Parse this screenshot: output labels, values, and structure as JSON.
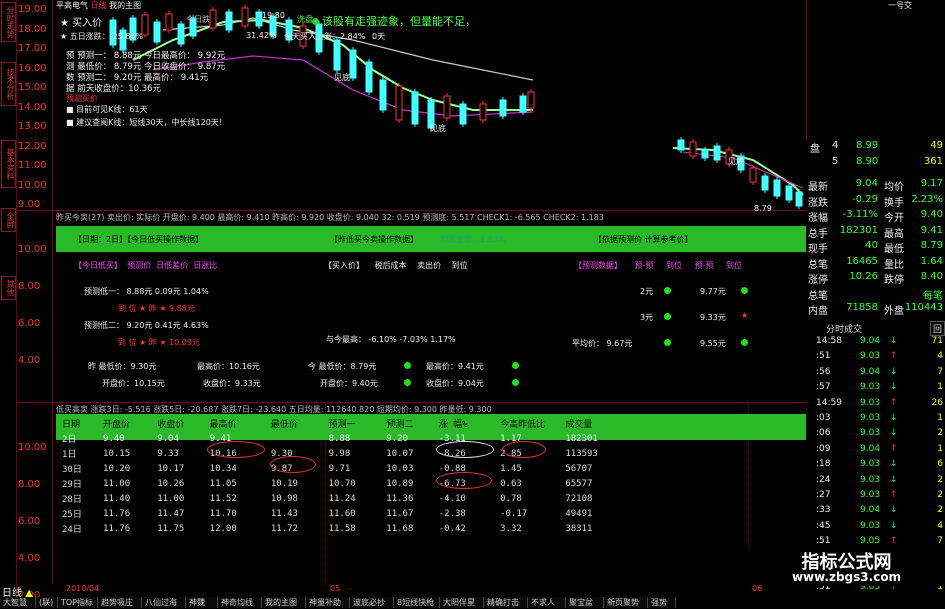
{
  "header": {
    "stock_name": "平高电气",
    "period_tag": "日线",
    "my_subject": "我的主图",
    "top_right": "一号交",
    "high_mark": "19.80",
    "buy_label": "买入价",
    "signal_text": "该股有走强迹象，但量能不足，",
    "five_day": "五日涨跌：-25.86%",
    "today_rise": "今日跌",
    "kc_label": "今天买入上涨：2.84%",
    "zero_day": "0天",
    "val_3142": "31.42%",
    "cm": "洗盘"
  },
  "info_overlay": {
    "lines": [
      "预  预测一： 8.88元   今日最高价： 9.92元",
      "测  最低价： 8.79元   今日收盘价： 9.87元",
      "数  预测二： 9.20元   最高价：   9.41元",
      "据                    前天收盘价：10.36元"
    ],
    "buy_sign": "预测买价",
    "visible": "目前可见K线：61天",
    "advice": "建议查阅K线：短线30天，中长线120天！"
  },
  "chart_labels": {
    "jiandi1": "见底",
    "jiandi2": "见底",
    "jiandi3": "见底",
    "low_mark": "8.79",
    "month": "2010/04",
    "month2": "05",
    "month3": "06"
  },
  "y_axis": [
    "19.00",
    "18.00",
    "17.00",
    "16.00",
    "15.00",
    "14.00",
    "13.00",
    "12.00",
    "11.00",
    "10.00",
    "9.00"
  ],
  "y_axis_mid": [
    "10.00",
    "8.00",
    "6.00",
    "4.00"
  ],
  "y_axis_bot": [
    "10.00",
    "8.00",
    "6.00",
    "4.00",
    "2.00"
  ],
  "left_tabs": [
    "分时走势",
    "技术分析",
    "基本资料",
    "全屏",
    "其他"
  ],
  "mid_header": {
    "text": "昨买今卖(27)  卖出价: 实际价  开盘价: 9.400  最高价: 9.410  昨高价: 9.920  收盘价: 9.040  32: 0.519  预测底: 5.517  CHECK1: -6.565  CHECK2: 1.183"
  },
  "section1": {
    "left": "【日期：2日】【今日低买操作数据】",
    "mid": "【昨低买今卖操作数据】",
    "mid2": "利润金额：1.93%",
    "right": "【依据预测价 计算参考价】"
  },
  "panel1": {
    "tabs_left": [
      "【今日低买】",
      "预测价",
      "日低差价",
      "日涨比"
    ],
    "tabs_mid": [
      "【买入价】",
      "税后成本",
      "卖出价",
      "到位"
    ],
    "tabs_right": [
      "【预测数据】",
      "预-预",
      "到位",
      "预-预",
      "到位"
    ],
    "pred1": "预测低一：  8.88元    0.09元    1.04%",
    "pos1": "到 位  ★  昨 ★ 9.88元",
    "pred2": "预测低二：  9.20元    0.41元    4.63%",
    "pos2": "到 位  ★  昨 ★ 10.09元",
    "diff_row": "与今最高：  -6.10%     -7.03%     1.17%",
    "r1": "2元",
    "r1v": "9.77元",
    "r2": "3元",
    "r2v": "9.33元",
    "avg": "平均价：  9.67元",
    "avgv": "9.55元",
    "yest_low": "昨  最低价：9.30元",
    "yest_high": "最高价：10.16元",
    "open": "开盘价：10.15元",
    "close": "收盘价：9.33元",
    "t_low": "今  最低价：8.79元",
    "t_high": "最高价：9.41元",
    "t_open": "开盘价：9.40元",
    "t_close": "收盘价：9.04元"
  },
  "low_header": {
    "text": "低买高卖  涨跌3日: -5.516  涨跌5日: -20.687  涨跌7日: -23.640  五日均量: 112640.820  短期均价: 9.300  昨量低: 9.300"
  },
  "table": {
    "headers": [
      "日期",
      "开盘价",
      "收盘价",
      "最高价",
      "最低价",
      "预测一",
      "预测二",
      "涨  幅%",
      "今高昨低比",
      "成交量"
    ],
    "rows": [
      [
        "2日",
        "9.40",
        "9.04",
        "9.41",
        "",
        "8.88",
        "9.20",
        "-3.11",
        "1.17",
        "182301"
      ],
      [
        "1日",
        "10.15",
        "9.33",
        "10.16",
        "9.30",
        "9.98",
        "10.07",
        "-8.26",
        "2.85",
        "113593"
      ],
      [
        "30日",
        "10.20",
        "10.17",
        "10.34",
        "9.87",
        "9.71",
        "10.03",
        "-0.88",
        "1.45",
        "56707"
      ],
      [
        "29日",
        "11.00",
        "10.26",
        "11.05",
        "10.19",
        "10.70",
        "10.89",
        "-6.73",
        "0.63",
        "65577"
      ],
      [
        "28日",
        "11.40",
        "11.00",
        "11.52",
        "10.98",
        "11.24",
        "11.36",
        "-4.10",
        "0.78",
        "72108"
      ],
      [
        "25日",
        "11.76",
        "11.47",
        "11.70",
        "11.43",
        "11.60",
        "11.67",
        "-2.38",
        "-0.17",
        "49491"
      ],
      [
        "24日",
        "11.76",
        "11.75",
        "12.00",
        "11.72",
        "11.58",
        "11.68",
        "-0.42",
        "3.32",
        "38311"
      ]
    ]
  },
  "right_panel": {
    "book": [
      [
        "盘",
        "4",
        "8.99",
        "49"
      ],
      [
        "",
        "5",
        "8.90",
        "361"
      ]
    ],
    "stats": [
      [
        "最新",
        "9.04",
        "均价",
        "9.17"
      ],
      [
        "涨跌",
        "-0.29",
        "换手",
        "2.23%"
      ],
      [
        "涨幅",
        "-3.11%",
        "今开",
        "9.40"
      ],
      [
        "总手",
        "182301",
        "最高",
        "9.41"
      ],
      [
        "现手",
        "40",
        "最低",
        "8.79"
      ],
      [
        "总笔",
        "16465",
        "量比",
        "1.64"
      ],
      [
        "涨停",
        "10.26",
        "跌停",
        "8.40"
      ],
      [
        "总笔",
        "",
        "",
        "每笔"
      ],
      [
        "内盘",
        "71858",
        "外盘",
        "110443"
      ]
    ],
    "tick_title": "分时成交",
    "tick_tab": "回",
    "ticks": [
      [
        "14:58",
        "9.04",
        "71"
      ],
      [
        ":51",
        "9.03",
        "4"
      ],
      [
        ":56",
        "9.04",
        "7"
      ],
      [
        ":57",
        "9.03",
        "1"
      ],
      [
        "14:59",
        "9.03",
        "26"
      ],
      [
        ":03",
        "9.03",
        "1"
      ],
      [
        ":06",
        "9.03",
        "2"
      ],
      [
        ":09",
        "9.04",
        "1"
      ],
      [
        ":18",
        "9.03",
        "6"
      ],
      [
        ":24",
        "9.03",
        "2"
      ],
      [
        ":27",
        "9.03",
        "2"
      ],
      [
        ":33",
        "9.04",
        "2"
      ],
      [
        ":45",
        "9.03",
        "4"
      ],
      [
        ":51",
        "9.05",
        "7"
      ],
      [
        ":56",
        "9.04",
        "1"
      ],
      [
        ":59",
        "9.04",
        "5"
      ],
      [
        ":51",
        "9.03",
        "1"
      ]
    ]
  },
  "bottom": {
    "label": "日线",
    "tabs": [
      "大智慧",
      "(联)",
      "TOP指标",
      "趋势吸庄",
      "八仙过海",
      "神魏",
      "神奇均线",
      "我的主图",
      "神量补助",
      "波底必抄",
      "8短线快枪",
      "大阳伴星",
      "精确打击",
      "不求人",
      "聚宝盆",
      "新页聚势",
      "强势"
    ]
  },
  "watermark": {
    "title": "指标公式网",
    "url": "www.zbgs3.com"
  },
  "colors": {
    "accent_green": "#29b929",
    "grid_red": "#7a0000",
    "up_red": "#ff3333",
    "down_cyan": "#44ffff"
  }
}
